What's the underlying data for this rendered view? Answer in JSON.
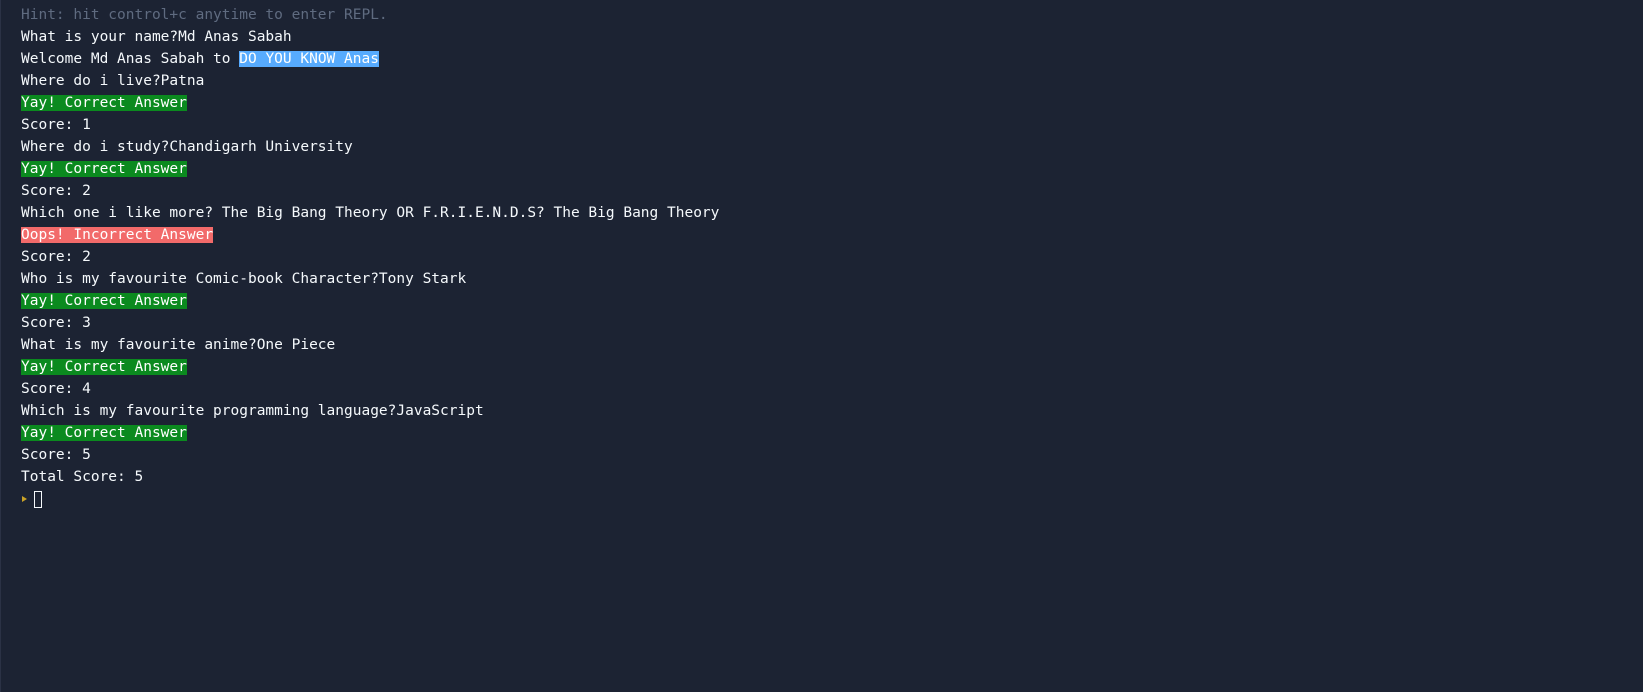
{
  "terminal": {
    "hint": "Hint: hit control+c anytime to enter REPL.",
    "lines": [
      {
        "text": "What is your name?Md Anas Sabah"
      },
      {
        "prefix": "Welcome Md Anas Sabah to ",
        "highlight": "DO YOU KNOW Anas"
      },
      {
        "text": "Where do i live?Patna"
      },
      {
        "result": "Yay! Correct Answer",
        "status": "correct"
      },
      {
        "text": "Score: 1"
      },
      {
        "text": "Where do i study?Chandigarh University"
      },
      {
        "result": "Yay! Correct Answer",
        "status": "correct"
      },
      {
        "text": "Score: 2"
      },
      {
        "text": "Which one i like more? The Big Bang Theory OR F.R.I.E.N.D.S? The Big Bang Theory"
      },
      {
        "result": "Oops! Incorrect Answer",
        "status": "incorrect"
      },
      {
        "text": "Score: 2"
      },
      {
        "text": "Who is my favourite Comic-book Character?Tony Stark"
      },
      {
        "result": "Yay! Correct Answer",
        "status": "correct"
      },
      {
        "text": "Score: 3"
      },
      {
        "text": "What is my favourite anime?One Piece"
      },
      {
        "result": "Yay! Correct Answer",
        "status": "correct"
      },
      {
        "text": "Score: 4"
      },
      {
        "text": "Which is my favourite programming language?JavaScript"
      },
      {
        "result": "Yay! Correct Answer",
        "status": "correct"
      },
      {
        "text": "Score: 5"
      },
      {
        "text": "Total Score: 5"
      }
    ],
    "prompt_icon": "prompt-arrow-icon"
  },
  "colors": {
    "background": "#1c2333",
    "text": "#f5f9fc",
    "hint": "#5f6b80",
    "highlight_blue": "#57abff",
    "correct": "#0b8a1f",
    "incorrect": "#f26a6a",
    "prompt": "#c9a227"
  }
}
